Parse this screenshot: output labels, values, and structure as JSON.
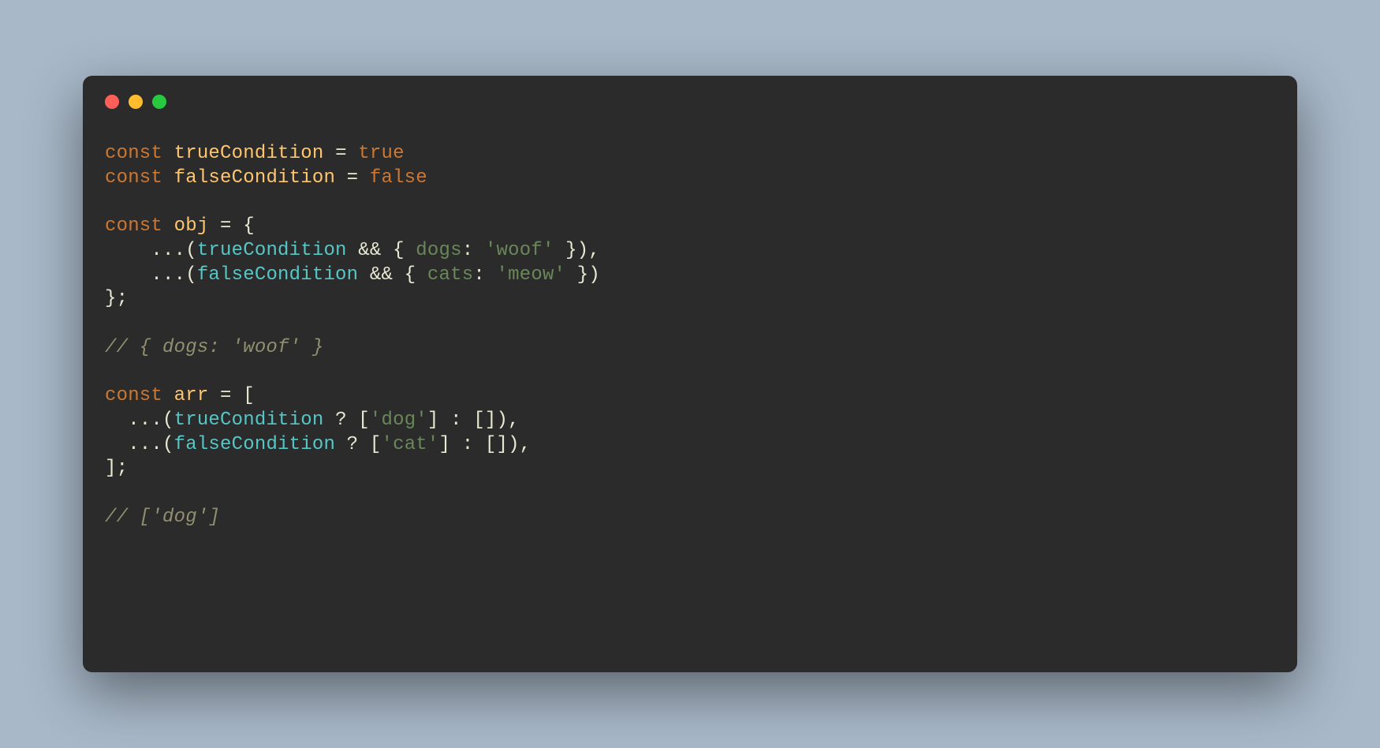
{
  "colors": {
    "background": "#a8b8c8",
    "window": "#2b2b2b",
    "traffic_red": "#ff5f56",
    "traffic_yellow": "#ffbd2e",
    "traffic_green": "#27c93f",
    "keyword": "#cc7832",
    "identifier": "#55c7c7",
    "var_def": "#ffc66d",
    "property": "#6a8759",
    "string": "#6a8759",
    "comment": "#909070",
    "default": "#e8e8d3"
  },
  "code": {
    "l1_const": "const",
    "l1_var": "trueCondition",
    "l1_eq": " = ",
    "l1_val": "true",
    "l2_const": "const",
    "l2_var": "falseCondition",
    "l2_eq": " = ",
    "l2_val": "false",
    "l4_const": "const",
    "l4_var": "obj",
    "l4_rest": " = {",
    "l5_indent": "    ...(",
    "l5_id": "trueCondition",
    "l5_and": " && { ",
    "l5_prop": "dogs",
    "l5_colon": ": ",
    "l5_str": "'woof'",
    "l5_close": " }),",
    "l6_indent": "    ...(",
    "l6_id": "falseCondition",
    "l6_and": " && { ",
    "l6_prop": "cats",
    "l6_colon": ": ",
    "l6_str": "'meow'",
    "l6_close": " })",
    "l7": "};",
    "l9_comment": "// { dogs: 'woof' }",
    "l11_const": "const",
    "l11_var": "arr",
    "l11_rest": " = [",
    "l12_indent": "  ...(",
    "l12_id": "trueCondition",
    "l12_q": " ? [",
    "l12_str": "'dog'",
    "l12_close": "] : []),",
    "l13_indent": "  ...(",
    "l13_id": "falseCondition",
    "l13_q": " ? [",
    "l13_str": "'cat'",
    "l13_close": "] : []),",
    "l14": "];",
    "l16_comment": "// ['dog']"
  }
}
